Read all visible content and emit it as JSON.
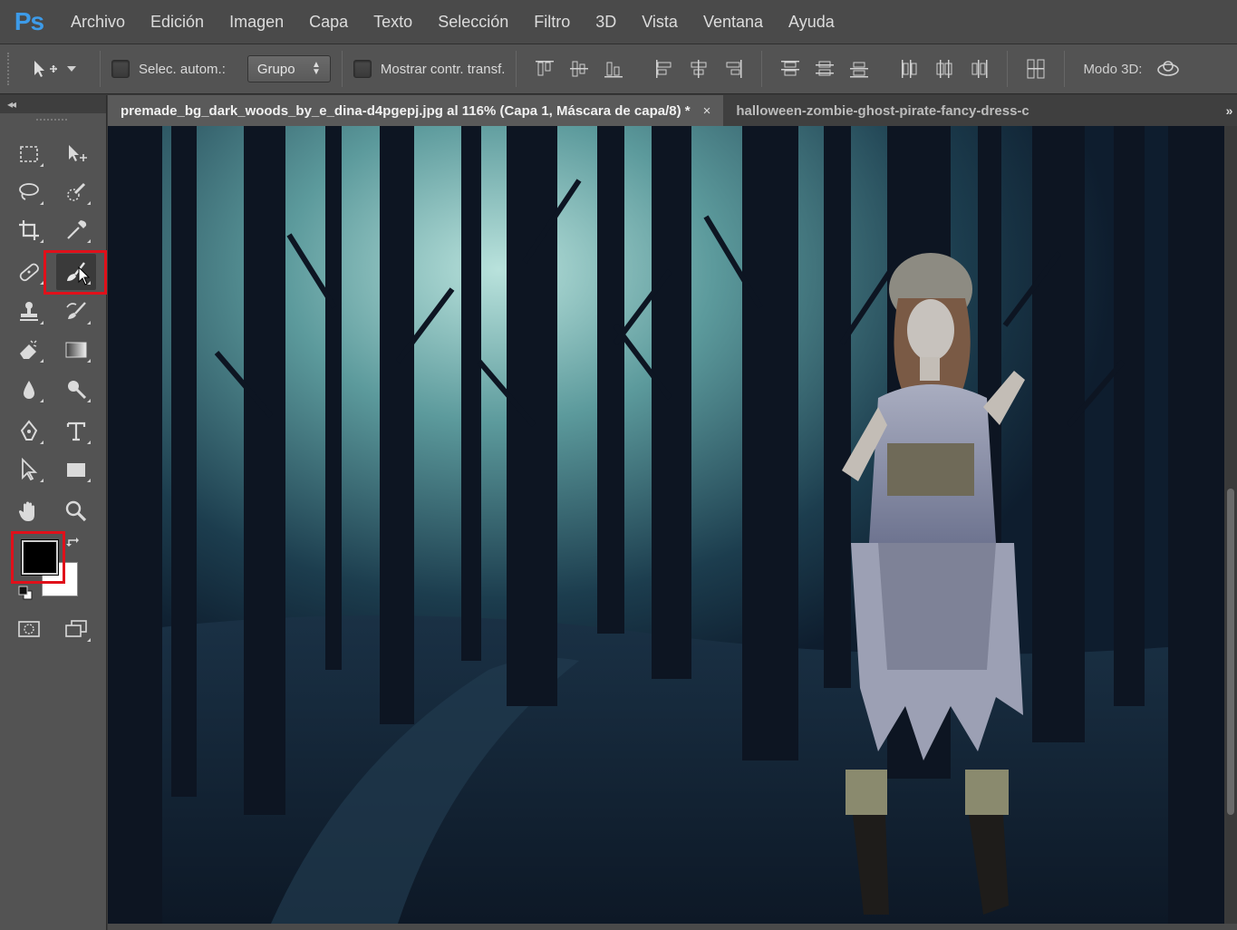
{
  "app": {
    "logo": "Ps",
    "menu": [
      "Archivo",
      "Edición",
      "Imagen",
      "Capa",
      "Texto",
      "Selección",
      "Filtro",
      "3D",
      "Vista",
      "Ventana",
      "Ayuda"
    ]
  },
  "options": {
    "auto_select_label": "Selec. autom.:",
    "auto_select_value": "Grupo",
    "show_transform_label": "Mostrar contr. transf.",
    "mode_3d_label": "Modo 3D:"
  },
  "toolbar": {
    "collapse_label": "◂◂",
    "foreground_color": "#000000",
    "background_color": "#ffffff",
    "active_tool": "brush-tool",
    "highlight_color": "#e0101a"
  },
  "tabs": [
    {
      "label": "premade_bg_dark_woods_by_e_dina-d4pgepj.jpg al 116% (Capa 1, Máscara de capa/8) *",
      "close": "×"
    },
    {
      "label": "halloween-zombie-ghost-pirate-fancy-dress-c"
    }
  ],
  "tab_overflow": "»"
}
